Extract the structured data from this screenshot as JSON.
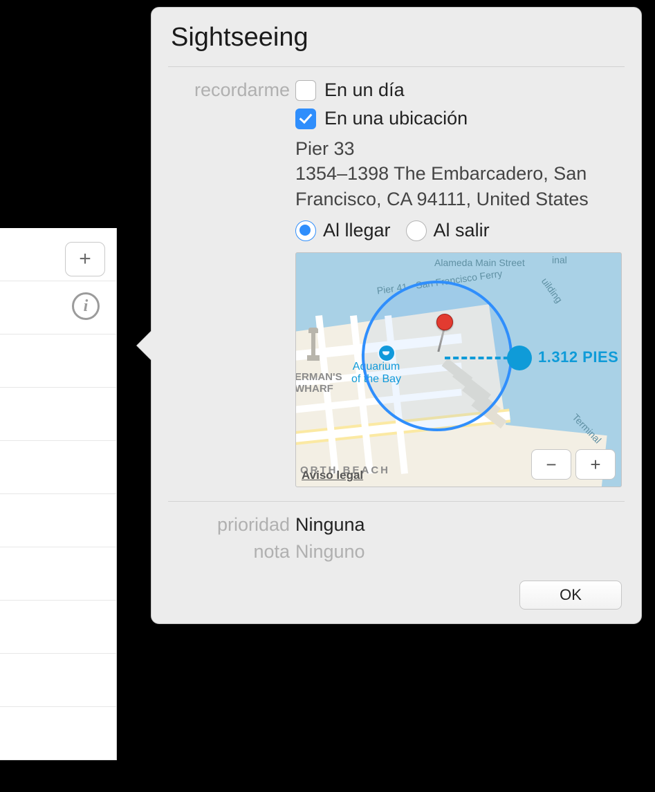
{
  "title": "Sightseeing",
  "remind": {
    "label": "recordarme",
    "day": {
      "label": "En un día",
      "checked": false
    },
    "location": {
      "label": "En una ubicación",
      "checked": true,
      "place_name": "Pier 33",
      "address": "1354–1398 The Embarcadero, San Francisco, CA  94111, United States",
      "arrive": {
        "label": "Al llegar",
        "selected": true
      },
      "leave": {
        "label": "Al salir",
        "selected": false
      }
    }
  },
  "map": {
    "radius_label": "1.312 PIES",
    "poi_aquarium": "Aquarium\nof the Bay",
    "street_alameda": "Alameda Main Street",
    "street_pier41": "Pier 41 - San Francisco Ferry",
    "street_term": "Terminal",
    "street_final_frag": "inal",
    "street_building": "uilding",
    "street_wharf": "ERMAN'S\nWHARF",
    "street_nbeach": "ORTH BEACH",
    "legal": "Aviso legal",
    "zoom_out": "−",
    "zoom_in": "+"
  },
  "priority": {
    "label": "prioridad",
    "value": "Ninguna"
  },
  "note": {
    "label": "nota",
    "placeholder": "Ninguno"
  },
  "ok": "OK",
  "add_plus": "+"
}
